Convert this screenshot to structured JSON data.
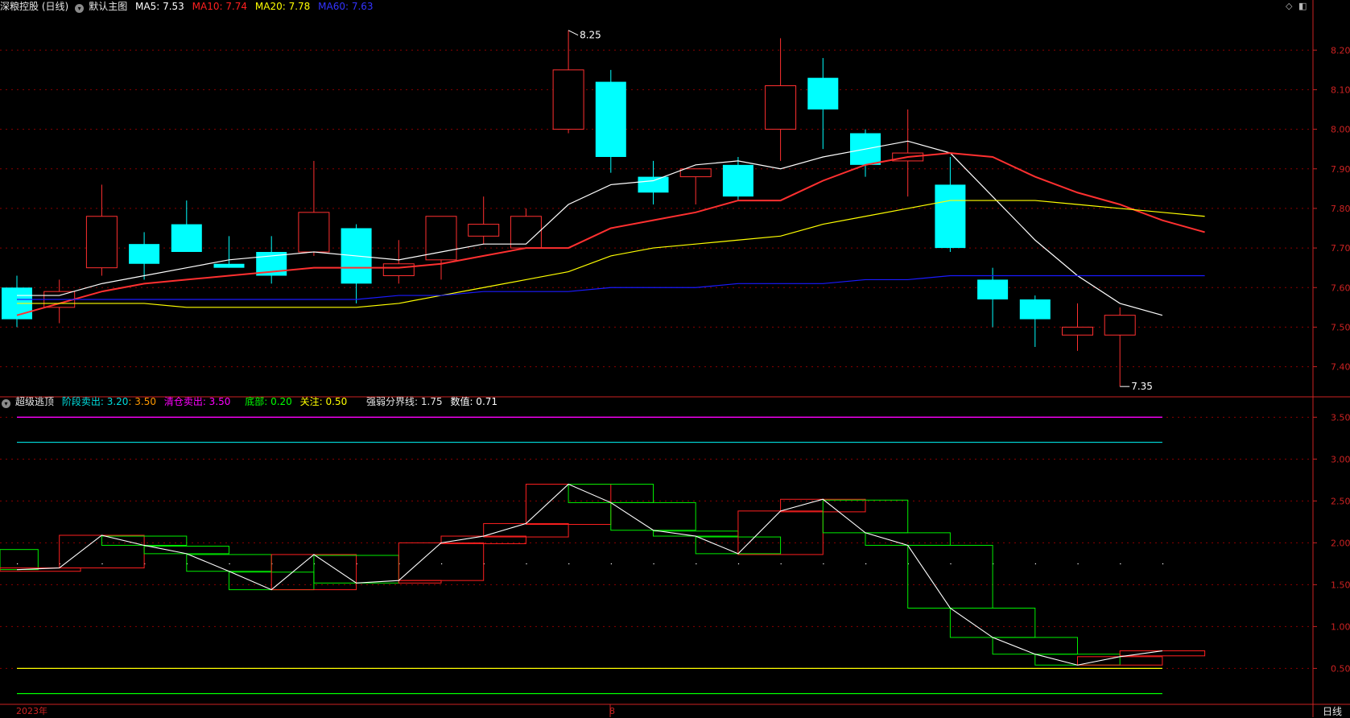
{
  "main_info": {
    "stock_title": "深粮控股 (日线)",
    "template": "默认主图",
    "ma5": {
      "label": "MA5: 7.53",
      "color": "#ffffff"
    },
    "ma10": {
      "label": "MA10: 7.74",
      "color": "#ff2020"
    },
    "ma20": {
      "label": "MA20: 7.78",
      "color": "#ffff00"
    },
    "ma60": {
      "label": "MA60: 7.63",
      "color": "#2b2bff"
    },
    "high_marker": "8.25",
    "low_marker": "7.35"
  },
  "ind_info": {
    "name": "超级逃顶",
    "stage_sell": "阶段卖出: 3.20",
    "stage_sell_2": ": 3.50",
    "clear_sell": "清仓卖出: 3.50",
    "bottom": "底部: 0.20",
    "focus": "关注: 0.50",
    "divider_line": "强弱分界线: 1.75",
    "value": "数值: 0.71"
  },
  "bottom_bar": {
    "year_label": "2023年",
    "month_label": "8",
    "period": "日线"
  },
  "colors": {
    "up": "#ff3030",
    "down": "#00ffff",
    "grid": "#8b0000",
    "axis": "#cc2222",
    "ind_up": "#ff2020",
    "ind_down": "#00ee00",
    "ind_line": "#ffffff",
    "level_clear": "#ff00ff",
    "level_stage": "#00cccc",
    "level_focus": "#ffff00",
    "level_bottom": "#00ff00"
  },
  "chart_data": [
    {
      "type": "candlestick",
      "y_ticks": [
        7.4,
        7.5,
        7.6,
        7.7,
        7.8,
        7.9,
        8.0,
        8.1,
        8.2
      ],
      "ylim": [
        7.33,
        8.29
      ],
      "candles": [
        {
          "o": 7.6,
          "h": 7.63,
          "l": 7.5,
          "c": 7.52
        },
        {
          "o": 7.55,
          "h": 7.62,
          "l": 7.51,
          "c": 7.59
        },
        {
          "o": 7.65,
          "h": 7.86,
          "l": 7.63,
          "c": 7.78
        },
        {
          "o": 7.71,
          "h": 7.74,
          "l": 7.62,
          "c": 7.66
        },
        {
          "o": 7.76,
          "h": 7.82,
          "l": 7.69,
          "c": 7.69
        },
        {
          "o": 7.66,
          "h": 7.73,
          "l": 7.65,
          "c": 7.65
        },
        {
          "o": 7.69,
          "h": 7.73,
          "l": 7.61,
          "c": 7.63
        },
        {
          "o": 7.69,
          "h": 7.92,
          "l": 7.68,
          "c": 7.79
        },
        {
          "o": 7.75,
          "h": 7.76,
          "l": 7.56,
          "c": 7.61
        },
        {
          "o": 7.63,
          "h": 7.72,
          "l": 7.61,
          "c": 7.66
        },
        {
          "o": 7.67,
          "h": 7.78,
          "l": 7.62,
          "c": 7.78
        },
        {
          "o": 7.73,
          "h": 7.83,
          "l": 7.71,
          "c": 7.76
        },
        {
          "o": 7.7,
          "h": 7.8,
          "l": 7.7,
          "c": 7.78
        },
        {
          "o": 8.0,
          "h": 8.25,
          "l": 7.99,
          "c": 8.15
        },
        {
          "o": 8.12,
          "h": 8.15,
          "l": 7.89,
          "c": 7.93
        },
        {
          "o": 7.88,
          "h": 7.92,
          "l": 7.81,
          "c": 7.84
        },
        {
          "o": 7.88,
          "h": 7.9,
          "l": 7.81,
          "c": 7.9
        },
        {
          "o": 7.91,
          "h": 7.93,
          "l": 7.82,
          "c": 7.83
        },
        {
          "o": 8.0,
          "h": 8.23,
          "l": 7.92,
          "c": 8.11
        },
        {
          "o": 8.13,
          "h": 8.18,
          "l": 7.95,
          "c": 8.05
        },
        {
          "o": 7.99,
          "h": 8.0,
          "l": 7.88,
          "c": 7.91
        },
        {
          "o": 7.92,
          "h": 8.05,
          "l": 7.83,
          "c": 7.94
        },
        {
          "o": 7.86,
          "h": 7.93,
          "l": 7.69,
          "c": 7.7
        },
        {
          "o": 7.62,
          "h": 7.65,
          "l": 7.5,
          "c": 7.57
        },
        {
          "o": 7.57,
          "h": 7.58,
          "l": 7.45,
          "c": 7.52
        },
        {
          "o": 7.48,
          "h": 7.56,
          "l": 7.44,
          "c": 7.5
        },
        {
          "o": 7.48,
          "h": 7.55,
          "l": 7.35,
          "c": 7.53
        }
      ],
      "series": [
        {
          "name": "MA5",
          "values": [
            7.58,
            7.58,
            7.61,
            7.63,
            7.65,
            7.67,
            7.68,
            7.69,
            7.68,
            7.67,
            7.69,
            7.71,
            7.71,
            7.81,
            7.86,
            7.87,
            7.91,
            7.92,
            7.9,
            7.93,
            7.95,
            7.97,
            7.94,
            7.83,
            7.72,
            7.63,
            7.56,
            7.53
          ]
        },
        {
          "name": "MA10",
          "values": [
            7.53,
            7.56,
            7.59,
            7.61,
            7.62,
            7.63,
            7.64,
            7.65,
            7.65,
            7.65,
            7.66,
            7.68,
            7.7,
            7.7,
            7.75,
            7.77,
            7.79,
            7.82,
            7.82,
            7.87,
            7.91,
            7.93,
            7.94,
            7.93,
            7.88,
            7.84,
            7.81,
            7.77,
            7.74
          ]
        },
        {
          "name": "MA20",
          "values": [
            7.56,
            7.56,
            7.56,
            7.56,
            7.55,
            7.55,
            7.55,
            7.55,
            7.55,
            7.56,
            7.58,
            7.6,
            7.62,
            7.64,
            7.68,
            7.7,
            7.71,
            7.72,
            7.73,
            7.76,
            7.78,
            7.8,
            7.82,
            7.82,
            7.82,
            7.81,
            7.8,
            7.79,
            7.78
          ]
        },
        {
          "name": "MA60",
          "values": [
            7.57,
            7.57,
            7.57,
            7.57,
            7.57,
            7.57,
            7.57,
            7.57,
            7.57,
            7.58,
            7.58,
            7.59,
            7.59,
            7.59,
            7.6,
            7.6,
            7.6,
            7.61,
            7.61,
            7.61,
            7.62,
            7.62,
            7.63,
            7.63,
            7.63,
            7.63,
            7.63,
            7.63,
            7.63
          ]
        }
      ]
    },
    {
      "type": "indicator",
      "y_ticks": [
        0.5,
        1.0,
        1.5,
        2.0,
        2.5,
        3.0,
        3.5
      ],
      "ylim": [
        0.1,
        3.58
      ],
      "levels": {
        "clear_sell": 3.5,
        "stage_sell": 3.2,
        "divider": 1.75,
        "focus": 0.5,
        "bottom": 0.2
      },
      "values": [
        1.68,
        1.7,
        2.09,
        1.97,
        1.87,
        1.66,
        1.44,
        1.86,
        1.52,
        1.55,
        2.0,
        2.08,
        2.23,
        2.7,
        2.48,
        2.15,
        2.08,
        1.87,
        2.38,
        2.52,
        2.12,
        1.97,
        1.22,
        0.87,
        0.67,
        0.54,
        0.64,
        0.71
      ],
      "boxes": [
        {
          "t": "down",
          "x0": 0,
          "x1": 1,
          "a": 1.92,
          "b": 1.68
        },
        {
          "t": "up",
          "x0": 0,
          "x1": 2,
          "a": 1.66,
          "b": 1.7
        },
        {
          "t": "up",
          "x0": 1.5,
          "x1": 3.5,
          "a": 1.7,
          "b": 2.09
        },
        {
          "t": "down",
          "x0": 2.5,
          "x1": 4.5,
          "a": 2.08,
          "b": 1.97
        },
        {
          "t": "down",
          "x0": 3.5,
          "x1": 5.5,
          "a": 1.96,
          "b": 1.87
        },
        {
          "t": "down",
          "x0": 4.5,
          "x1": 6.5,
          "a": 1.86,
          "b": 1.66
        },
        {
          "t": "down",
          "x0": 5.5,
          "x1": 7.5,
          "a": 1.65,
          "b": 1.44
        },
        {
          "t": "up",
          "x0": 6.5,
          "x1": 8.5,
          "a": 1.44,
          "b": 1.86
        },
        {
          "t": "down",
          "x0": 7.5,
          "x1": 9.5,
          "a": 1.85,
          "b": 1.52
        },
        {
          "t": "up",
          "x0": 9.5,
          "x1": 10.5,
          "a": 1.52,
          "b": 1.55
        },
        {
          "t": "up",
          "x0": 9.5,
          "x1": 11.5,
          "a": 1.55,
          "b": 2.0
        },
        {
          "t": "up",
          "x0": 10.5,
          "x1": 12.5,
          "a": 1.99,
          "b": 2.08
        },
        {
          "t": "up",
          "x0": 11.5,
          "x1": 13.5,
          "a": 2.07,
          "b": 2.23
        },
        {
          "t": "up",
          "x0": 12.5,
          "x1": 14.5,
          "a": 2.22,
          "b": 2.7
        },
        {
          "t": "down",
          "x0": 13.5,
          "x1": 15.5,
          "a": 2.7,
          "b": 2.48
        },
        {
          "t": "down",
          "x0": 14.5,
          "x1": 16.5,
          "a": 2.48,
          "b": 2.15
        },
        {
          "t": "down",
          "x0": 15.5,
          "x1": 17.5,
          "a": 2.14,
          "b": 2.08
        },
        {
          "t": "down",
          "x0": 16.5,
          "x1": 18.5,
          "a": 2.07,
          "b": 1.87
        },
        {
          "t": "up",
          "x0": 17.5,
          "x1": 19.5,
          "a": 1.86,
          "b": 2.38
        },
        {
          "t": "up",
          "x0": 18.5,
          "x1": 20.5,
          "a": 2.37,
          "b": 2.52
        },
        {
          "t": "down",
          "x0": 19.5,
          "x1": 21.5,
          "a": 2.51,
          "b": 2.12
        },
        {
          "t": "down",
          "x0": 20.5,
          "x1": 22.5,
          "a": 2.12,
          "b": 1.97
        },
        {
          "t": "down",
          "x0": 21.5,
          "x1": 23.5,
          "a": 1.97,
          "b": 1.22
        },
        {
          "t": "down",
          "x0": 22.5,
          "x1": 24.5,
          "a": 1.22,
          "b": 0.87
        },
        {
          "t": "down",
          "x0": 23.5,
          "x1": 25.5,
          "a": 0.87,
          "b": 0.67
        },
        {
          "t": "down",
          "x0": 24.5,
          "x1": 26.5,
          "a": 0.67,
          "b": 0.54
        },
        {
          "t": "up",
          "x0": 25.5,
          "x1": 27.5,
          "a": 0.54,
          "b": 0.64
        },
        {
          "t": "up",
          "x0": 26.5,
          "x1": 28.5,
          "a": 0.65,
          "b": 0.71
        }
      ]
    }
  ]
}
